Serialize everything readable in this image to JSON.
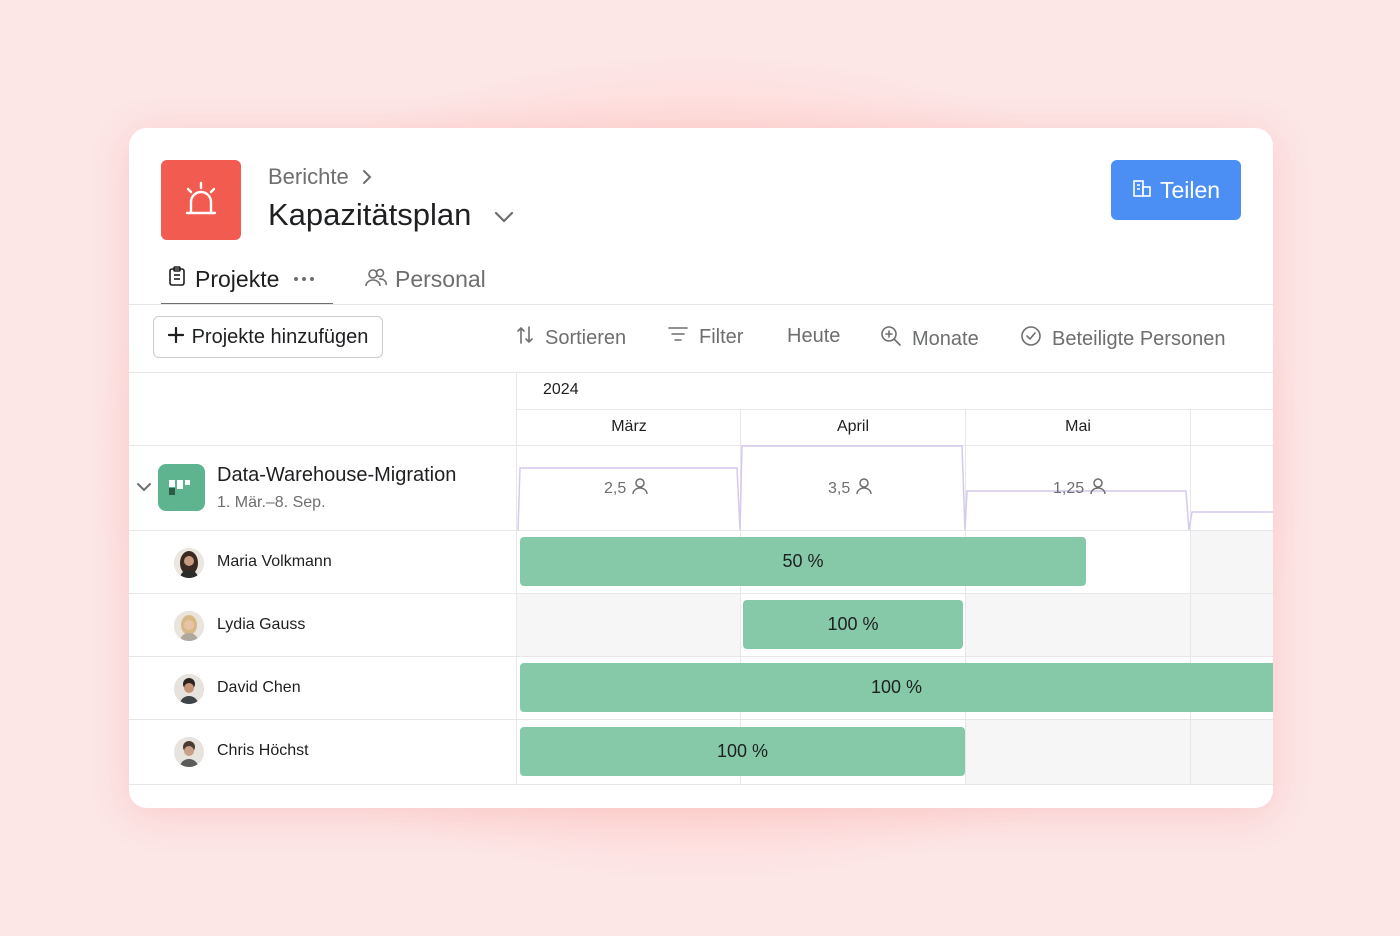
{
  "header": {
    "breadcrumb": "Berichte",
    "title": "Kapazitätsplan",
    "share_label": "Teilen",
    "app_icon": "siren-icon"
  },
  "tabs": [
    {
      "label": "Projekte",
      "icon": "clipboard-icon",
      "active": true
    },
    {
      "label": "Personal",
      "icon": "people-icon",
      "active": false
    }
  ],
  "toolbar": {
    "add_label": "Projekte hinzufügen",
    "sort_label": "Sortieren",
    "filter_label": "Filter",
    "today_label": "Heute",
    "months_label": "Monate",
    "people_label": "Beteiligte Personen"
  },
  "timeline": {
    "year": "2024",
    "months": [
      "März",
      "April",
      "Mai"
    ]
  },
  "project": {
    "name": "Data-Warehouse-Migration",
    "dates": "1. Mär.–8. Sep.",
    "capacity": [
      "2,5",
      "3,5",
      "1,25"
    ]
  },
  "people": [
    {
      "name": "Maria Volkmann",
      "allocation": "50 %"
    },
    {
      "name": "Lydia Gauss",
      "allocation": "100 %"
    },
    {
      "name": "David Chen",
      "allocation": "100 %"
    },
    {
      "name": "Chris Höchst",
      "allocation": "100 %"
    }
  ],
  "colors": {
    "accent": "#f15b50",
    "share_button": "#4b8ff5",
    "bar": "#86c9a8",
    "project_icon": "#5db48f",
    "background": "#fde6e6"
  }
}
